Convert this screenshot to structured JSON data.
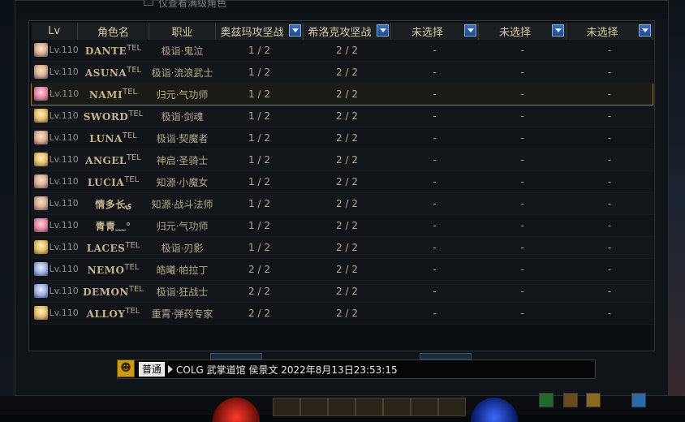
{
  "top_checkbox_label": "仅查看满级角色",
  "table": {
    "headers": {
      "lv": "Lv",
      "name": "角色名",
      "job": "职业",
      "col1": "奥兹玛攻坚战",
      "col2": "希洛克攻坚战",
      "col3": "未选择",
      "col4": "未选择",
      "col5": "未选择"
    },
    "rows": [
      {
        "lv": "Lv.110",
        "name": "DANTE",
        "job": "极诣·鬼泣",
        "c1": "1 / 2",
        "c2": "2 / 2",
        "c3": "-",
        "c4": "-",
        "c5": "-",
        "avatar": "avatar-icon"
      },
      {
        "lv": "Lv.110",
        "name": "ASUNA",
        "job": "极诣·流浪武士",
        "c1": "1 / 2",
        "c2": "2 / 2",
        "c3": "-",
        "c4": "-",
        "c5": "-",
        "avatar": "avatar-icon"
      },
      {
        "lv": "Lv.110",
        "name": "NAMI",
        "job": "归元·气功师",
        "c1": "1 / 2",
        "c2": "2 / 2",
        "c3": "-",
        "c4": "-",
        "c5": "-",
        "avatar": "avatar-icon"
      },
      {
        "lv": "Lv.110",
        "name": "SWORD",
        "job": "极诣·剑魂",
        "c1": "1 / 2",
        "c2": "2 / 2",
        "c3": "-",
        "c4": "-",
        "c5": "-",
        "avatar": "avatar-icon"
      },
      {
        "lv": "Lv.110",
        "name": "LUNA",
        "job": "极诣·契魔者",
        "c1": "1 / 2",
        "c2": "2 / 2",
        "c3": "-",
        "c4": "-",
        "c5": "-",
        "avatar": "avatar-icon"
      },
      {
        "lv": "Lv.110",
        "name": "ANGEL",
        "job": "神启·圣骑士",
        "c1": "1 / 2",
        "c2": "2 / 2",
        "c3": "-",
        "c4": "-",
        "c5": "-",
        "avatar": "avatar-icon"
      },
      {
        "lv": "Lv.110",
        "name": "LUCIA",
        "job": "知源·小魔女",
        "c1": "1 / 2",
        "c2": "2 / 2",
        "c3": "-",
        "c4": "-",
        "c5": "-",
        "avatar": "avatar-icon"
      },
      {
        "lv": "Lv.110",
        "name": "情多长ۍ",
        "job": "知源·战斗法师",
        "c1": "1 / 2",
        "c2": "2 / 2",
        "c3": "-",
        "c4": "-",
        "c5": "-",
        "avatar": "avatar-icon"
      },
      {
        "lv": "Lv.110",
        "name": "青青﹏°",
        "job": "归元·气功师",
        "c1": "1 / 2",
        "c2": "2 / 2",
        "c3": "-",
        "c4": "-",
        "c5": "-",
        "avatar": "avatar-icon"
      },
      {
        "lv": "Lv.110",
        "name": "LACES",
        "job": "极诣·刃影",
        "c1": "1 / 2",
        "c2": "2 / 2",
        "c3": "-",
        "c4": "-",
        "c5": "-",
        "avatar": "avatar-icon"
      },
      {
        "lv": "Lv.110",
        "name": "NEMO",
        "job": "皓曦·帕拉丁",
        "c1": "2 / 2",
        "c2": "2 / 2",
        "c3": "-",
        "c4": "-",
        "c5": "-",
        "avatar": "avatar-icon"
      },
      {
        "lv": "Lv.110",
        "name": "DEMON",
        "job": "极诣·狂战士",
        "c1": "2 / 2",
        "c2": "2 / 2",
        "c3": "-",
        "c4": "-",
        "c5": "-",
        "avatar": "avatar-icon"
      },
      {
        "lv": "Lv.110",
        "name": "ALLOY",
        "job": "重霄·弹药专家",
        "c1": "2 / 2",
        "c2": "2 / 2",
        "c3": "-",
        "c4": "-",
        "c5": "-",
        "avatar": "avatar-icon"
      }
    ],
    "suffix": "TEL"
  },
  "chat": {
    "channel": "普通",
    "message": "COLG 武掌道馆 侯景文 2022年8月13日23:53:15"
  },
  "colors": {
    "incomplete": "#ff4040",
    "complete": "#5fdc44",
    "selected_border": "#9a7a2e"
  }
}
